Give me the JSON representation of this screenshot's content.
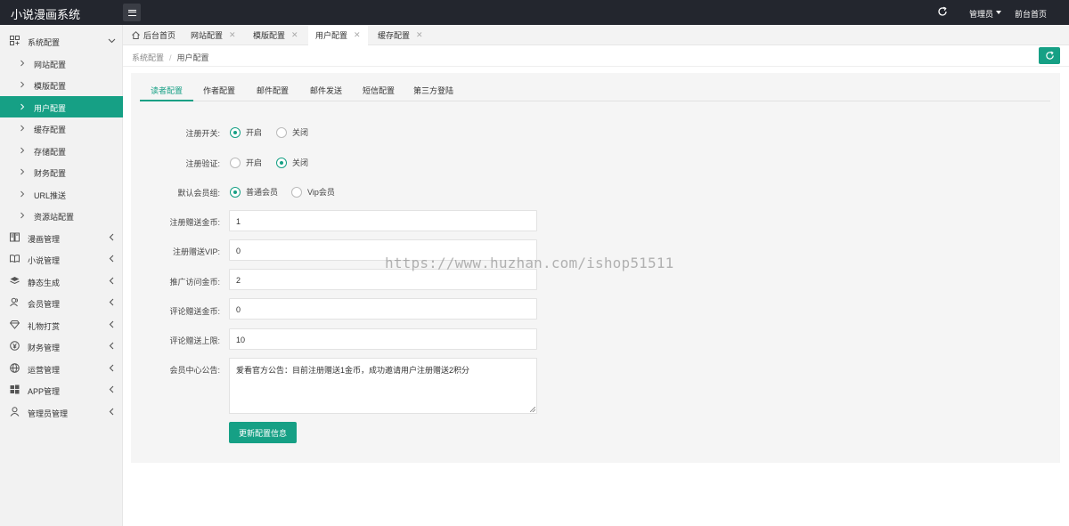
{
  "app": {
    "title": "小说漫画系统",
    "admin_label": "管理员",
    "front_home_label": "前台首页"
  },
  "theme": {
    "accent": "#16a085",
    "topbar_bg": "#23262e"
  },
  "sidebar": {
    "groups": [
      {
        "label": "系统配置",
        "icon": "settings-icon",
        "expanded": true
      },
      {
        "label": "漫画管理",
        "icon": "comic-icon"
      },
      {
        "label": "小说管理",
        "icon": "book-icon"
      },
      {
        "label": "静态生成",
        "icon": "layers-icon"
      },
      {
        "label": "会员管理",
        "icon": "user-group-icon"
      },
      {
        "label": "礼物打赏",
        "icon": "diamond-icon"
      },
      {
        "label": "财务管理",
        "icon": "yen-icon"
      },
      {
        "label": "运营管理",
        "icon": "globe-icon"
      },
      {
        "label": "APP管理",
        "icon": "windows-icon"
      },
      {
        "label": "管理员管理",
        "icon": "user-icon"
      }
    ],
    "sub_items": [
      {
        "label": "网站配置"
      },
      {
        "label": "模版配置"
      },
      {
        "label": "用户配置",
        "active": true
      },
      {
        "label": "缓存配置"
      },
      {
        "label": "存储配置"
      },
      {
        "label": "财务配置"
      },
      {
        "label": "URL推送"
      },
      {
        "label": "资源站配置"
      }
    ]
  },
  "page_tabs": [
    {
      "label": "后台首页",
      "icon": "home-icon"
    },
    {
      "label": "网站配置",
      "closable": true
    },
    {
      "label": "模版配置",
      "closable": true
    },
    {
      "label": "用户配置",
      "closable": true,
      "active": true
    },
    {
      "label": "缓存配置",
      "closable": true
    }
  ],
  "breadcrumb": {
    "parent": "系统配置",
    "separator": "/",
    "current": "用户配置"
  },
  "sub_tabs": [
    {
      "label": "读者配置",
      "active": true
    },
    {
      "label": "作者配置"
    },
    {
      "label": "邮件配置"
    },
    {
      "label": "邮件发送"
    },
    {
      "label": "短信配置"
    },
    {
      "label": "第三方登陆"
    }
  ],
  "form": {
    "register_switch": {
      "label": "注册开关:",
      "options": [
        "开启",
        "关闭"
      ],
      "selected": "开启"
    },
    "register_verify": {
      "label": "注册验证:",
      "options": [
        "开启",
        "关闭"
      ],
      "selected": "关闭"
    },
    "default_group": {
      "label": "默认会员组:",
      "options": [
        "普通会员",
        "Vip会员"
      ],
      "selected": "普通会员"
    },
    "register_gold": {
      "label": "注册赠送金币:",
      "value": "1"
    },
    "register_vip": {
      "label": "注册赠送VIP:",
      "value": "0"
    },
    "promo_gold": {
      "label": "推广访问金币:",
      "value": "2"
    },
    "comment_gold": {
      "label": "评论赠送金币:",
      "value": "0"
    },
    "comment_limit": {
      "label": "评论赠送上限:",
      "value": "10"
    },
    "notice": {
      "label": "会员中心公告:",
      "value": "爱看官方公告：目前注册赠送1金币，成功邀请用户注册赠送2积分"
    },
    "submit_label": "更新配置信息"
  },
  "watermark": "https://www.huzhan.com/ishop51511"
}
